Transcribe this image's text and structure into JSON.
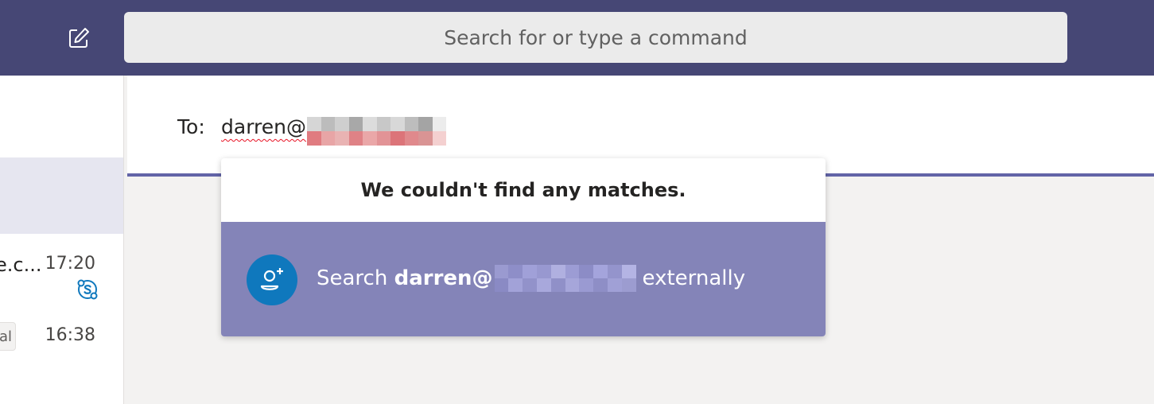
{
  "topbar": {
    "compose_icon": "compose-icon",
    "search_placeholder": "Search for or type a command"
  },
  "chat_list": {
    "items": [
      {
        "name": "e.c...",
        "time": "17:20",
        "badge_icon": "skype-icon"
      },
      {
        "badge": "al",
        "time": "16:38"
      }
    ]
  },
  "compose": {
    "to_label": "To:",
    "to_value": "darren@"
  },
  "suggestions": {
    "no_match_text": "We couldn't find any matches.",
    "search_prefix": "Search",
    "search_query": "darren@",
    "search_suffix": "externally",
    "search_icon": "add-person-icon"
  },
  "colors": {
    "topbar": "#464775",
    "accent": "#6264a7",
    "dropdown_highlight": "#8484b8",
    "avatar": "#0f78bd",
    "skype": "#0f78bd"
  }
}
